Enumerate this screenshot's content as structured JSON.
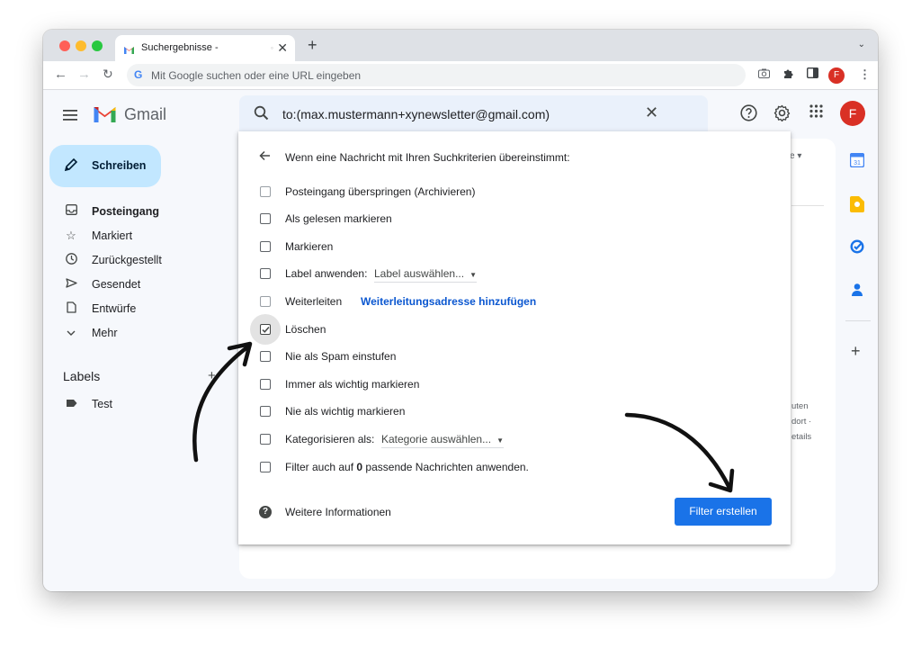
{
  "browser": {
    "tab_title": "Suchergebnisse -",
    "omnibox_placeholder": "Mit Google suchen oder eine URL eingeben",
    "profile_initial": "F"
  },
  "gmail": {
    "brand": "Gmail",
    "compose_label": "Schreiben",
    "nav": [
      {
        "label": "Posteingang",
        "icon": "inbox-icon"
      },
      {
        "label": "Markiert",
        "icon": "star-icon"
      },
      {
        "label": "Zurückgestellt",
        "icon": "clock-icon"
      },
      {
        "label": "Gesendet",
        "icon": "send-icon"
      },
      {
        "label": "Entwürfe",
        "icon": "draft-icon"
      },
      {
        "label": "Mehr",
        "icon": "chevron-down-icon"
      }
    ],
    "labels_heading": "Labels",
    "labels": [
      {
        "label": "Test",
        "icon": "label-icon"
      }
    ],
    "search_value": "to:(max.mustermann+xynewsletter@gmail.com)",
    "avatar_initial": "F",
    "background_snippets": [
      "uten",
      "dort ·",
      "etails"
    ]
  },
  "filter_dialog": {
    "title": "Wenn eine Nachricht mit Ihren Suchkriterien übereinstimmt:",
    "options": [
      {
        "label": "Posteingang überspringen (Archivieren)",
        "checked": false
      },
      {
        "label": "Als gelesen markieren",
        "checked": false
      },
      {
        "label": "Markieren",
        "checked": false
      },
      {
        "label": "Label anwenden:",
        "checked": false,
        "select": "Label auswählen..."
      },
      {
        "label": "Weiterleiten",
        "checked": false,
        "link": "Weiterleitungsadresse hinzufügen"
      },
      {
        "label": "Löschen",
        "checked": true
      },
      {
        "label": "Nie als Spam einstufen",
        "checked": false
      },
      {
        "label": "Immer als wichtig markieren",
        "checked": false
      },
      {
        "label": "Nie als wichtig markieren",
        "checked": false
      },
      {
        "label": "Kategorisieren als:",
        "checked": false,
        "select": "Kategorie auswählen..."
      },
      {
        "label_prefix": "Filter auch auf",
        "count": "0",
        "label_suffix": "passende Nachrichten anwenden.",
        "checked": false
      }
    ],
    "help_label": "Weitere Informationen",
    "create_button": "Filter erstellen"
  },
  "colors": {
    "accent_blue": "#1a73e8",
    "compose_bg": "#c2e7ff",
    "link_blue": "#0b57d0",
    "avatar_red": "#d93025"
  }
}
